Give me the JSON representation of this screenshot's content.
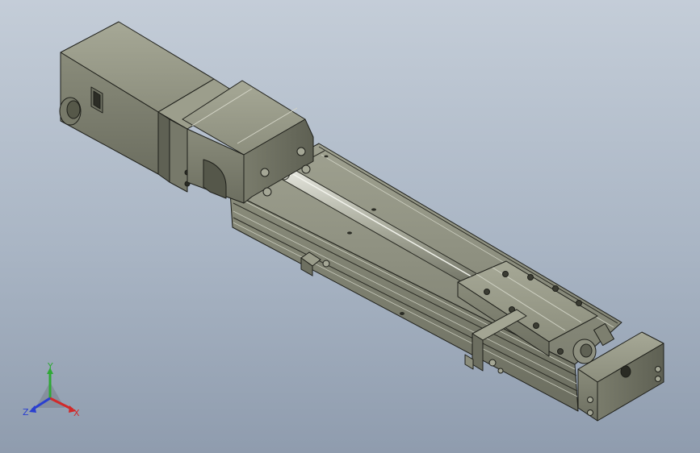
{
  "viewport": {
    "background_top": "#c4cdd8",
    "background_bottom": "#8f9cae"
  },
  "model": {
    "parts": [
      "motor-housing",
      "motor-flange",
      "coupling-block",
      "base-rail",
      "ball-screw",
      "carriage",
      "clamp-bracket",
      "end-bearing-block"
    ],
    "body_color": "#8a8d7c",
    "shadow_color": "#4a4c42",
    "edge_color": "#1e1f1a"
  },
  "triad": {
    "y_label": "Y",
    "z_label": "Z",
    "x_label": "X",
    "y_color": "#2fa836",
    "z_color": "#2a3fd0",
    "x_color": "#d12a2a"
  }
}
